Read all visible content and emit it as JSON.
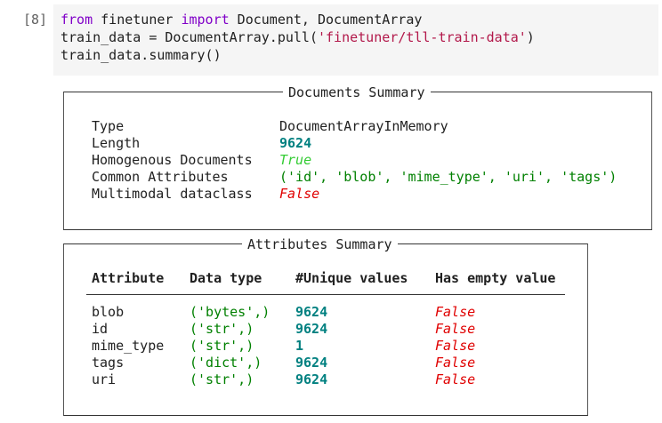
{
  "cell": {
    "prompt": "[8]",
    "line1": {
      "kw1": "from",
      "mod": " finetuner ",
      "kw2": "import",
      "rest": " Document, DocumentArray"
    },
    "line2": {
      "pre": "train_data = DocumentArray.pull(",
      "str": "'finetuner/tll-train-data'",
      "post": ")"
    },
    "line3": "train_data.summary()"
  },
  "documents_summary": {
    "title": "Documents Summary",
    "rows": [
      {
        "label": "Type",
        "value": "DocumentArrayInMemory"
      },
      {
        "label": "Length",
        "value": "9624"
      },
      {
        "label": "Homogenous Documents",
        "value": "True"
      },
      {
        "label": "Common Attributes",
        "value": "('id', 'blob', 'mime_type', 'uri', 'tags')"
      },
      {
        "label": "Multimodal dataclass",
        "value": "False"
      }
    ]
  },
  "attributes_summary": {
    "title": "Attributes Summary",
    "headers": [
      "Attribute",
      "Data type",
      "#Unique values",
      "Has empty value"
    ],
    "rows": [
      [
        "blob",
        "('bytes',)",
        "9624",
        "False"
      ],
      [
        "id",
        "('str',)",
        "9624",
        "False"
      ],
      [
        "mime_type",
        "('str',)",
        "1",
        "False"
      ],
      [
        "tags",
        "('dict',)",
        "9624",
        "False"
      ],
      [
        "uri",
        "('str',)",
        "9624",
        "False"
      ]
    ]
  }
}
